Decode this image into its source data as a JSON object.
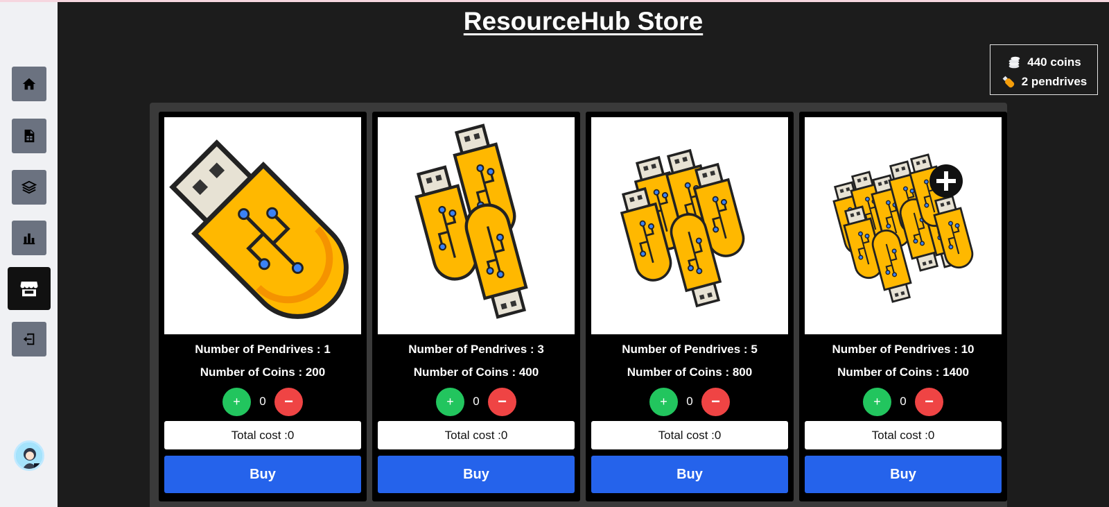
{
  "page": {
    "title": "ResourceHub Store"
  },
  "sidebar": {
    "items": [
      {
        "name": "home",
        "icon": "home-icon"
      },
      {
        "name": "sheet",
        "icon": "spreadsheet-file-icon"
      },
      {
        "name": "layers",
        "icon": "layers-icon"
      },
      {
        "name": "stats",
        "icon": "bar-chart-icon"
      },
      {
        "name": "store",
        "icon": "store-icon",
        "active": true
      },
      {
        "name": "logout",
        "icon": "logout-icon"
      }
    ],
    "avatar_icon": "user-avatar"
  },
  "wallet": {
    "coins_label": "440 coins",
    "pendrives_label": "2 pendrives",
    "coins_icon": "coin-stack-icon",
    "pendrive_icon": "pendrive-icon"
  },
  "products": [
    {
      "pendrives_text": "Number of Pendrives : 1",
      "coins_text": "Number of Coins : 200",
      "quantity": "0",
      "plus": "+",
      "minus": "−",
      "total_text": "Total cost :0",
      "buy_label": "Buy"
    },
    {
      "pendrives_text": "Number of Pendrives : 3",
      "coins_text": "Number of Coins : 400",
      "quantity": "0",
      "plus": "+",
      "minus": "−",
      "total_text": "Total cost :0",
      "buy_label": "Buy"
    },
    {
      "pendrives_text": "Number of Pendrives : 5",
      "coins_text": "Number of Coins : 800",
      "quantity": "0",
      "plus": "+",
      "minus": "−",
      "total_text": "Total cost :0",
      "buy_label": "Buy"
    },
    {
      "pendrives_text": "Number of Pendrives : 10",
      "coins_text": "Number of Coins : 1400",
      "quantity": "0",
      "plus": "+",
      "minus": "−",
      "total_text": "Total cost :0",
      "buy_label": "Buy"
    }
  ],
  "colors": {
    "background": "#1c1c1c",
    "sidebar": "#f0f1f4",
    "plus": "#22c55e",
    "minus": "#ef4444",
    "buy": "#2563eb",
    "pendrive_body": "#ffb800"
  }
}
